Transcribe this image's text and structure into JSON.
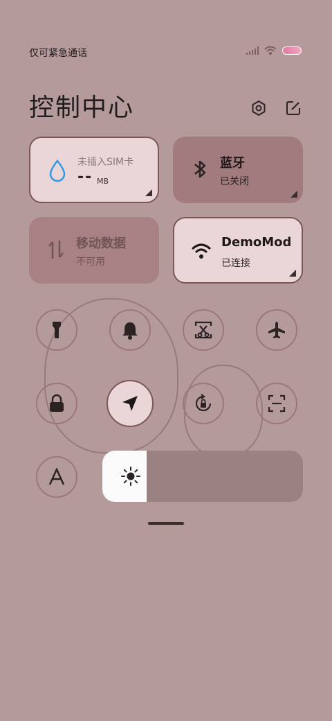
{
  "status": {
    "text": "仅可紧急通话"
  },
  "header": {
    "title": "控制中心"
  },
  "tiles": {
    "data": {
      "sim_text": "未插入SIM卡",
      "value": "--",
      "unit": "MB"
    },
    "bluetooth": {
      "title": "蓝牙",
      "status": "已关闭"
    },
    "mobile": {
      "title": "移动数据",
      "status": "不可用"
    },
    "wifi": {
      "title": "DemoMod",
      "status": "已连接"
    }
  },
  "brightness": {
    "level": 0.22
  },
  "icons": [
    "signal-icon",
    "wifi-status-icon",
    "battery-icon",
    "settings-icon",
    "edit-icon",
    "water-drop-icon",
    "bluetooth-icon",
    "data-arrows-icon",
    "wifi-icon",
    "flashlight-icon",
    "bell-icon",
    "screenshot-icon",
    "airplane-icon",
    "lock-icon",
    "location-arrow-icon",
    "rotation-lock-icon",
    "scan-icon",
    "font-icon",
    "sun-icon"
  ],
  "colors": {
    "background": "#b59a9c",
    "tile_active": "#ead6d7",
    "tile_inactive": "#a17b7e",
    "accent_drop": "#2b9be7"
  }
}
